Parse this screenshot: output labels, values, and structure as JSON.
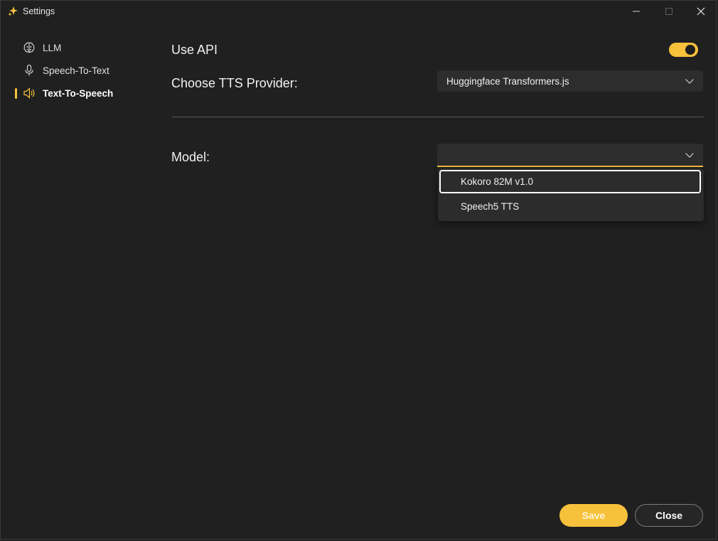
{
  "window": {
    "title": "Settings",
    "accent_color": "#f7c13b"
  },
  "sidebar": {
    "items": [
      {
        "label": "LLM",
        "icon": "brain-icon",
        "active": false
      },
      {
        "label": "Speech-To-Text",
        "icon": "microphone-icon",
        "active": false
      },
      {
        "label": "Text-To-Speech",
        "icon": "speaker-icon",
        "active": true
      }
    ]
  },
  "main": {
    "use_api": {
      "label": "Use API",
      "enabled": true
    },
    "tts_provider": {
      "label": "Choose TTS Provider:",
      "selected": "Huggingface Transformers.js"
    },
    "model": {
      "label": "Model:",
      "selected": "",
      "options": [
        "Kokoro 82M v1.0",
        "Speech5 TTS"
      ]
    }
  },
  "footer": {
    "save_label": "Save",
    "close_label": "Close"
  }
}
